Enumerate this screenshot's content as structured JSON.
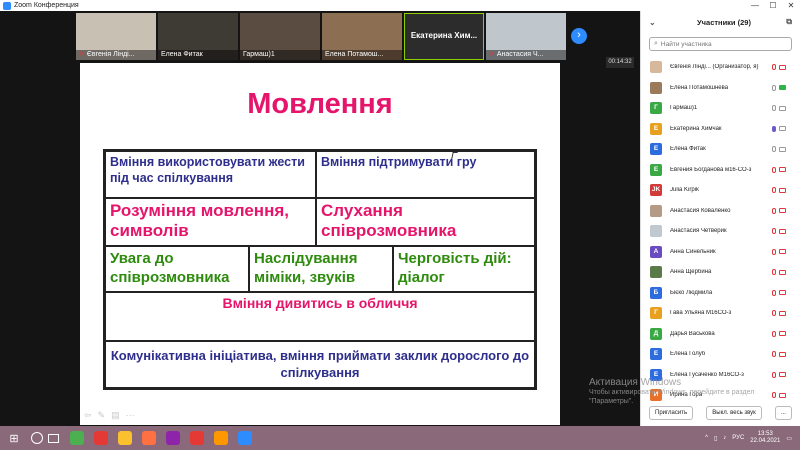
{
  "window": {
    "title": "Zoom Конференция",
    "controls": [
      "—",
      "☐",
      "✕"
    ]
  },
  "thumbnails": [
    {
      "name": "Євгенія Лінді...",
      "muted": true,
      "color": "#c9c0b4"
    },
    {
      "name": "Елена Фитак",
      "muted": false,
      "color": "#3e3a34"
    },
    {
      "name": "Гармаш)1",
      "muted": false,
      "color": "#5a4c40"
    },
    {
      "name": "Елена Потамош...",
      "muted": false,
      "color": "#8c6e52"
    },
    {
      "name": "Екатерина Хим...",
      "muted": false,
      "textonly": true
    },
    {
      "name": "Анастасия Ч...",
      "muted": true,
      "color": "#bfc6cc"
    }
  ],
  "timer": "00:14:32",
  "slide": {
    "title": "Мовлення",
    "cells": {
      "gestures": "Вміння використовувати жести під час спілкування",
      "support_game": "Вміння підтримувати гру",
      "understanding": "Розуміння мовлення, символів",
      "listening": "Слухання співрозмовника",
      "attention": "Увага до співрозмовника",
      "imitation": "Наслідування міміки, звуків",
      "turn_taking": "Черговість дій: діалог",
      "eye_contact": "Вміння дивитись в обличчя",
      "initiative": "Комунікативна ініціатива, вміння приймати заклик дорослого до спілкування"
    },
    "colors": {
      "title": "#e5156b",
      "blue": "#2e2e8c",
      "green": "#2e8b0e"
    }
  },
  "participants": {
    "header": "Участники (29)",
    "search_placeholder": "Найти участника",
    "items": [
      {
        "name": "Євгенія Лінді... (Организатор, я)",
        "avatar": "",
        "avatar_color": "#d8b89a",
        "video": "off",
        "mic": "off"
      },
      {
        "name": "Елена Потамошнева",
        "avatar": "",
        "avatar_color": "#9a7a5a",
        "video": "green",
        "mic": "idle"
      },
      {
        "name": "Гармаш)1",
        "avatar": "Г",
        "avatar_color": "#3aa845",
        "video": "idle",
        "mic": "idle"
      },
      {
        "name": "Екатерина Химчак",
        "avatar": "Е",
        "avatar_color": "#e8a020",
        "video": "idle",
        "mic": "on"
      },
      {
        "name": "Елена Фитак",
        "avatar": "Е",
        "avatar_color": "#2d6cdf",
        "video": "idle",
        "mic": "idle"
      },
      {
        "name": "Евгения Богданова м16-СО-з",
        "avatar": "Е",
        "avatar_color": "#3aa845",
        "video": "off",
        "mic": "off"
      },
      {
        "name": "Julia Kirpik",
        "avatar": "JK",
        "avatar_color": "#d33a3a",
        "video": "off",
        "mic": "off"
      },
      {
        "name": "Анастасия Коваленко",
        "avatar": "",
        "avatar_color": "#b59a86",
        "video": "off",
        "mic": "off"
      },
      {
        "name": "Анастасия Четверик",
        "avatar": "",
        "avatar_color": "#c0c8d0",
        "video": "off",
        "mic": "off"
      },
      {
        "name": "Анна Синельник",
        "avatar": "А",
        "avatar_color": "#6a4cc2",
        "video": "off",
        "mic": "off"
      },
      {
        "name": "Анна Щербина",
        "avatar": "",
        "avatar_color": "#5a7a4a",
        "video": "off",
        "mic": "off"
      },
      {
        "name": "Бієко Людмила",
        "avatar": "Б",
        "avatar_color": "#2d6cdf",
        "video": "off",
        "mic": "off"
      },
      {
        "name": "Гава Ульяна М16СО-з",
        "avatar": "Г",
        "avatar_color": "#e8a020",
        "video": "off",
        "mic": "off"
      },
      {
        "name": "Дарья Васькова",
        "avatar": "Д",
        "avatar_color": "#3aa845",
        "video": "off",
        "mic": "off"
      },
      {
        "name": "Елена Голуб",
        "avatar": "Е",
        "avatar_color": "#2d6cdf",
        "video": "off",
        "mic": "off"
      },
      {
        "name": "Елена Гусаченко М16СО-з",
        "avatar": "Е",
        "avatar_color": "#2d6cdf",
        "video": "off",
        "mic": "off"
      },
      {
        "name": "Ирина Гора",
        "avatar": "И",
        "avatar_color": "#e8702a",
        "video": "off",
        "mic": "off"
      }
    ],
    "invite_label": "Пригласить",
    "mute_all_label": "Выкл. весь звук",
    "more_label": "..."
  },
  "watermark": {
    "title": "Активация Windows",
    "line1": "Чтобы активировать Windows, перейдите в раздел",
    "line2": "\"Параметры\"."
  },
  "taskbar": {
    "apps": [
      {
        "name": "chrome",
        "color": "#4caf50"
      },
      {
        "name": "opera",
        "color": "#e53935"
      },
      {
        "name": "files",
        "color": "#fbc02d"
      },
      {
        "name": "firefox",
        "color": "#ff7043"
      },
      {
        "name": "media",
        "color": "#8e24aa"
      },
      {
        "name": "yandex",
        "color": "#e53935"
      },
      {
        "name": "paint",
        "color": "#ff9800"
      },
      {
        "name": "zoom",
        "color": "#2d8cff"
      }
    ],
    "lang": "РУС",
    "time": "13:53",
    "date": "22.04.2021"
  }
}
